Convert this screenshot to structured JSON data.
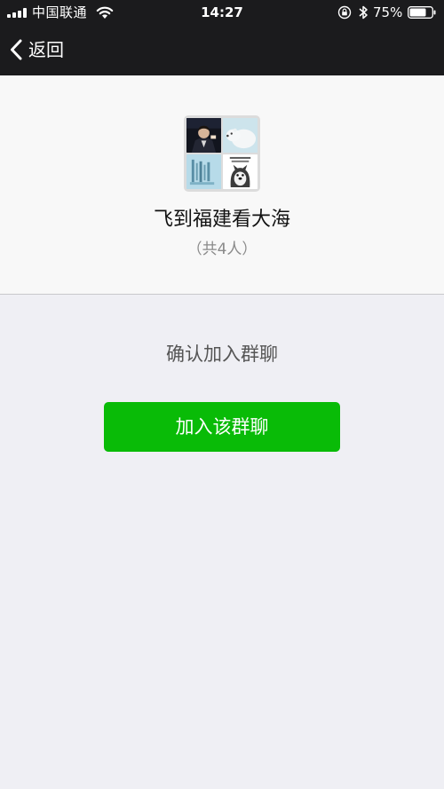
{
  "status_bar": {
    "carrier": "中国联通",
    "time": "14:27",
    "battery_percent_text": "75%",
    "battery_level": 0.75,
    "icons": [
      "signal-icon",
      "wifi-icon",
      "orientation-lock-icon",
      "bluetooth-icon",
      "battery-icon"
    ]
  },
  "nav": {
    "back_label": "返回",
    "back_icon": "chevron-left-icon"
  },
  "group": {
    "name": "飞到福建看大海",
    "member_count_text": "（共4人）",
    "avatar_icons": [
      "member-avatar-person",
      "member-avatar-polar-bear",
      "member-avatar-blue-text",
      "member-avatar-cartoon-dog"
    ]
  },
  "confirm": {
    "prompt": "确认加入群聊",
    "join_button_label": "加入该群聊"
  },
  "colors": {
    "header_bg": "#1b1b1d",
    "page_bg": "#efeff4",
    "card_bg": "#f8f8f8",
    "primary_button": "#09bb07",
    "secondary_text": "#8a8a8a"
  }
}
